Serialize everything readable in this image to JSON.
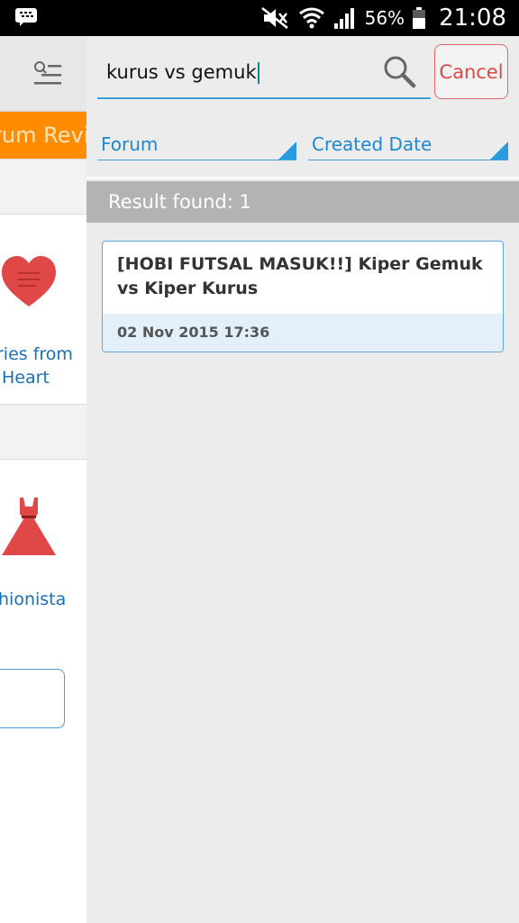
{
  "status_bar": {
    "battery_percent": "56%",
    "time": "21:08",
    "icons": [
      "bbm-icon",
      "mute-icon",
      "wifi-icon",
      "signal-icon",
      "battery-icon"
    ]
  },
  "background_screen": {
    "banner_text": "rum Revi",
    "items": [
      {
        "label_line1": "ries from",
        "label_line2": "Heart",
        "icon": "heart-icon"
      },
      {
        "label_line1": "hionista",
        "icon": "dress-icon"
      }
    ]
  },
  "search": {
    "query": "kurus vs gemuk",
    "cancel_label": "Cancel"
  },
  "filters": {
    "forum_label": "Forum",
    "date_label": "Created Date"
  },
  "results": {
    "summary": "Result found: 1",
    "items": [
      {
        "title": "[HOBI FUTSAL MASUK!!] Kiper Gemuk vs Kiper Kurus",
        "date": "02 Nov 2015 17:36"
      }
    ]
  },
  "colors": {
    "accent_blue": "#1e88d0",
    "cancel_red": "#e04848",
    "banner_orange": "#ff8c00",
    "result_bar": "#b3b3b3"
  }
}
